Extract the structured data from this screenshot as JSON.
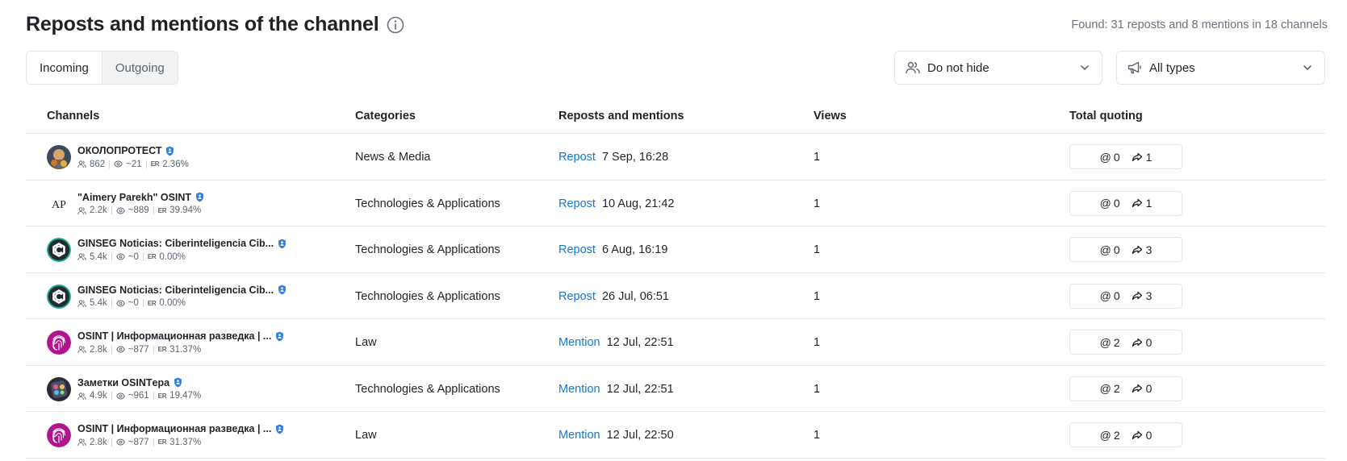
{
  "header": {
    "title": "Reposts and mentions of the channel",
    "found_text": "Found: 31 reposts and 8 mentions in 18 channels"
  },
  "tabs": [
    {
      "label": "Incoming",
      "active": true
    },
    {
      "label": "Outgoing",
      "active": false
    }
  ],
  "filters": {
    "hide": {
      "label": "Do not hide",
      "icon": "users-icon"
    },
    "types": {
      "label": "All types",
      "icon": "megaphone-icon"
    }
  },
  "table": {
    "headers": {
      "channels": "Channels",
      "categories": "Categories",
      "reposts": "Reposts and mentions",
      "views": "Views",
      "total": "Total quoting"
    },
    "rows": [
      {
        "name": "ОКОЛОПРОТЕСТ",
        "verified": true,
        "subscribers": "862",
        "reach": "~21",
        "er_label": "ER",
        "er": "2.36%",
        "category": "News & Media",
        "type": "Repost",
        "date": "7 Sep, 16:28",
        "views": "1",
        "mentions": "0",
        "reposts": "1",
        "avatar": "photo-warm"
      },
      {
        "name": "\"Aimery Parekh\" OSINT",
        "verified": true,
        "subscribers": "2.2k",
        "reach": "~889",
        "er_label": "ER",
        "er": "39.94%",
        "category": "Technologies & Applications",
        "type": "Repost",
        "date": "10 Aug, 21:42",
        "views": "1",
        "mentions": "0",
        "reposts": "1",
        "avatar": "monogram-ap",
        "avatar_text": "AP"
      },
      {
        "name": "GINSEG Noticias: Ciberinteligencia Cib...",
        "verified": true,
        "subscribers": "5.4k",
        "reach": "~0",
        "er_label": "ER",
        "er": "0.00%",
        "category": "Technologies & Applications",
        "type": "Repost",
        "date": "6 Aug, 16:19",
        "views": "1",
        "mentions": "0",
        "reposts": "3",
        "avatar": "ginseg-logo"
      },
      {
        "name": "GINSEG Noticias: Ciberinteligencia Cib...",
        "verified": true,
        "subscribers": "5.4k",
        "reach": "~0",
        "er_label": "ER",
        "er": "0.00%",
        "category": "Technologies & Applications",
        "type": "Repost",
        "date": "26 Jul, 06:51",
        "views": "1",
        "mentions": "0",
        "reposts": "3",
        "avatar": "ginseg-logo"
      },
      {
        "name": "OSINT | Информационная разведка | ...",
        "verified": true,
        "subscribers": "2.8k",
        "reach": "~877",
        "er_label": "ER",
        "er": "31.37%",
        "category": "Law",
        "type": "Mention",
        "date": "12 Jul, 22:51",
        "views": "1",
        "mentions": "2",
        "reposts": "0",
        "avatar": "fingerprint-logo"
      },
      {
        "name": "Заметки OSINTера",
        "verified": true,
        "subscribers": "4.9k",
        "reach": "~961",
        "er_label": "ER",
        "er": "19.47%",
        "category": "Technologies & Applications",
        "type": "Mention",
        "date": "12 Jul, 22:51",
        "views": "1",
        "mentions": "2",
        "reposts": "0",
        "avatar": "photo-colorful"
      },
      {
        "name": "OSINT | Информационная разведка | ...",
        "verified": true,
        "subscribers": "2.8k",
        "reach": "~877",
        "er_label": "ER",
        "er": "31.37%",
        "category": "Law",
        "type": "Mention",
        "date": "12 Jul, 22:50",
        "views": "1",
        "mentions": "2",
        "reposts": "0",
        "avatar": "fingerprint-logo"
      }
    ]
  },
  "colors": {
    "link": "#1677d2",
    "verified": "#2f7fe0",
    "fingerprint": "#b1148f",
    "ginseg": "#17a88b"
  }
}
